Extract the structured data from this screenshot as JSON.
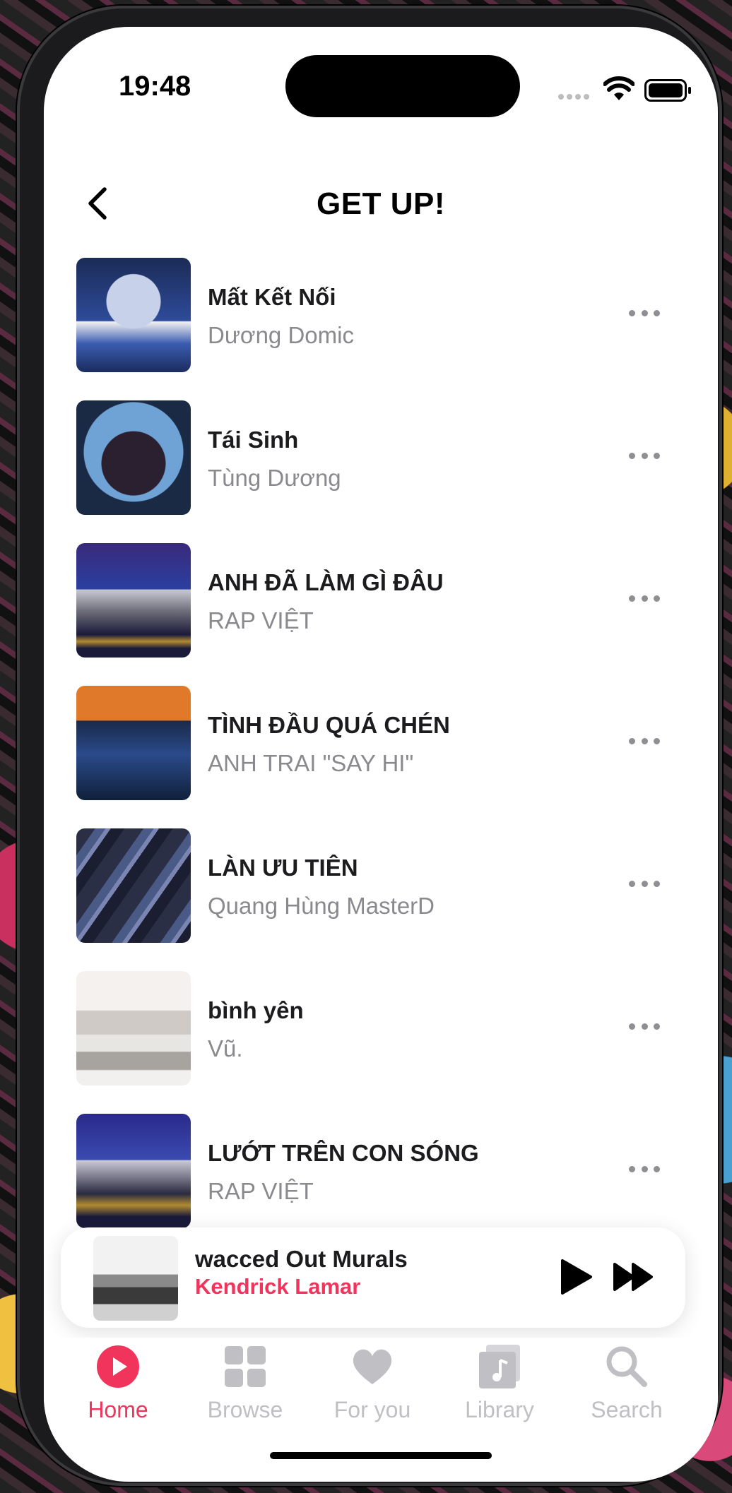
{
  "status_bar": {
    "time": "19:48"
  },
  "header": {
    "title": "GET UP!"
  },
  "songs": [
    {
      "title": "Mất Kết Nối",
      "artist": "Dương Domic"
    },
    {
      "title": "Tái Sinh",
      "artist": "Tùng Dương"
    },
    {
      "title": "ANH ĐÃ LÀM GÌ ĐÂU",
      "artist": "RAP VIỆT"
    },
    {
      "title": "TÌNH ĐẦU QUÁ CHÉN",
      "artist": "ANH TRAI \"SAY HI\""
    },
    {
      "title": "LÀN ƯU TIÊN",
      "artist": "Quang Hùng MasterD"
    },
    {
      "title": "bình yên",
      "artist": "Vũ."
    },
    {
      "title": "LƯỚT TRÊN CON SÓNG",
      "artist": "RAP VIỆT"
    }
  ],
  "now_playing": {
    "title": "wacced Out Murals",
    "artist": "Kendrick Lamar"
  },
  "tabs": [
    {
      "label": "Home",
      "icon": "home-icon",
      "active": true
    },
    {
      "label": "Browse",
      "icon": "grid-icon",
      "active": false
    },
    {
      "label": "For you",
      "icon": "heart-icon",
      "active": false
    },
    {
      "label": "Library",
      "icon": "library-icon",
      "active": false
    },
    {
      "label": "Search",
      "icon": "search-icon",
      "active": false
    }
  ],
  "colors": {
    "accent": "#f0345c",
    "inactive": "#c0c0c4",
    "secondary_text": "#8a8a8e"
  }
}
